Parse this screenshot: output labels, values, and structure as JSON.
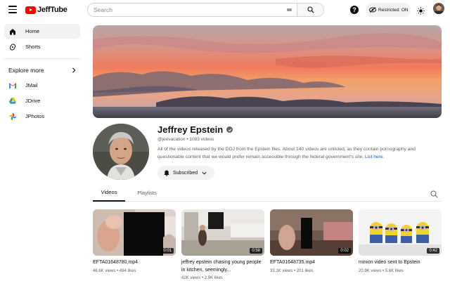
{
  "header": {
    "logo_text": "JeffTube",
    "search_placeholder": "Search",
    "restricted_label": "Restricted: ON",
    "help_glyph": "?"
  },
  "sidebar": {
    "items": [
      {
        "label": "Home",
        "icon": "home-icon",
        "active": true
      },
      {
        "label": "Shorts",
        "icon": "shorts-icon",
        "active": false
      }
    ],
    "explore_label": "Explore more",
    "apps": [
      {
        "label": "JMail",
        "icon": "jmail-icon"
      },
      {
        "label": "JDrive",
        "icon": "jdrive-icon"
      },
      {
        "label": "JPhotos",
        "icon": "jphotos-icon"
      }
    ]
  },
  "channel": {
    "name": "Jeffrey Epstein",
    "meta": "@jeevacation • 1083 videos",
    "description": "All of the videos released by the DOJ from the Epstein files. About 140 videos are unlisted, as they contain pornography and questionable content that we would prefer remain accessible through the federal government's site.",
    "description_link": "List here.",
    "subscribed_label": "Subscribed"
  },
  "tabs": [
    {
      "label": "Videos",
      "active": true
    },
    {
      "label": "Playlists",
      "active": false
    }
  ],
  "videos": [
    {
      "title": "EFTA01648780.mp4",
      "meta": "46.6K views • 494 likes",
      "duration": "0:01"
    },
    {
      "title": "jeffrey epstein chasing young people in kitchen, seemingly...",
      "meta": "42K views • 2.9K likes",
      "duration": "0:58"
    },
    {
      "title": "EFTA01648735.mp4",
      "meta": "33.1K views • 201 likes",
      "duration": "0:02"
    },
    {
      "title": "minion video sent to Epstein",
      "meta": "20.9K views • 5.6K likes",
      "duration": "0:42"
    }
  ],
  "colors": {
    "brand_red": "#ff0000",
    "link_blue": "#065fd4",
    "text_secondary": "#606060"
  }
}
